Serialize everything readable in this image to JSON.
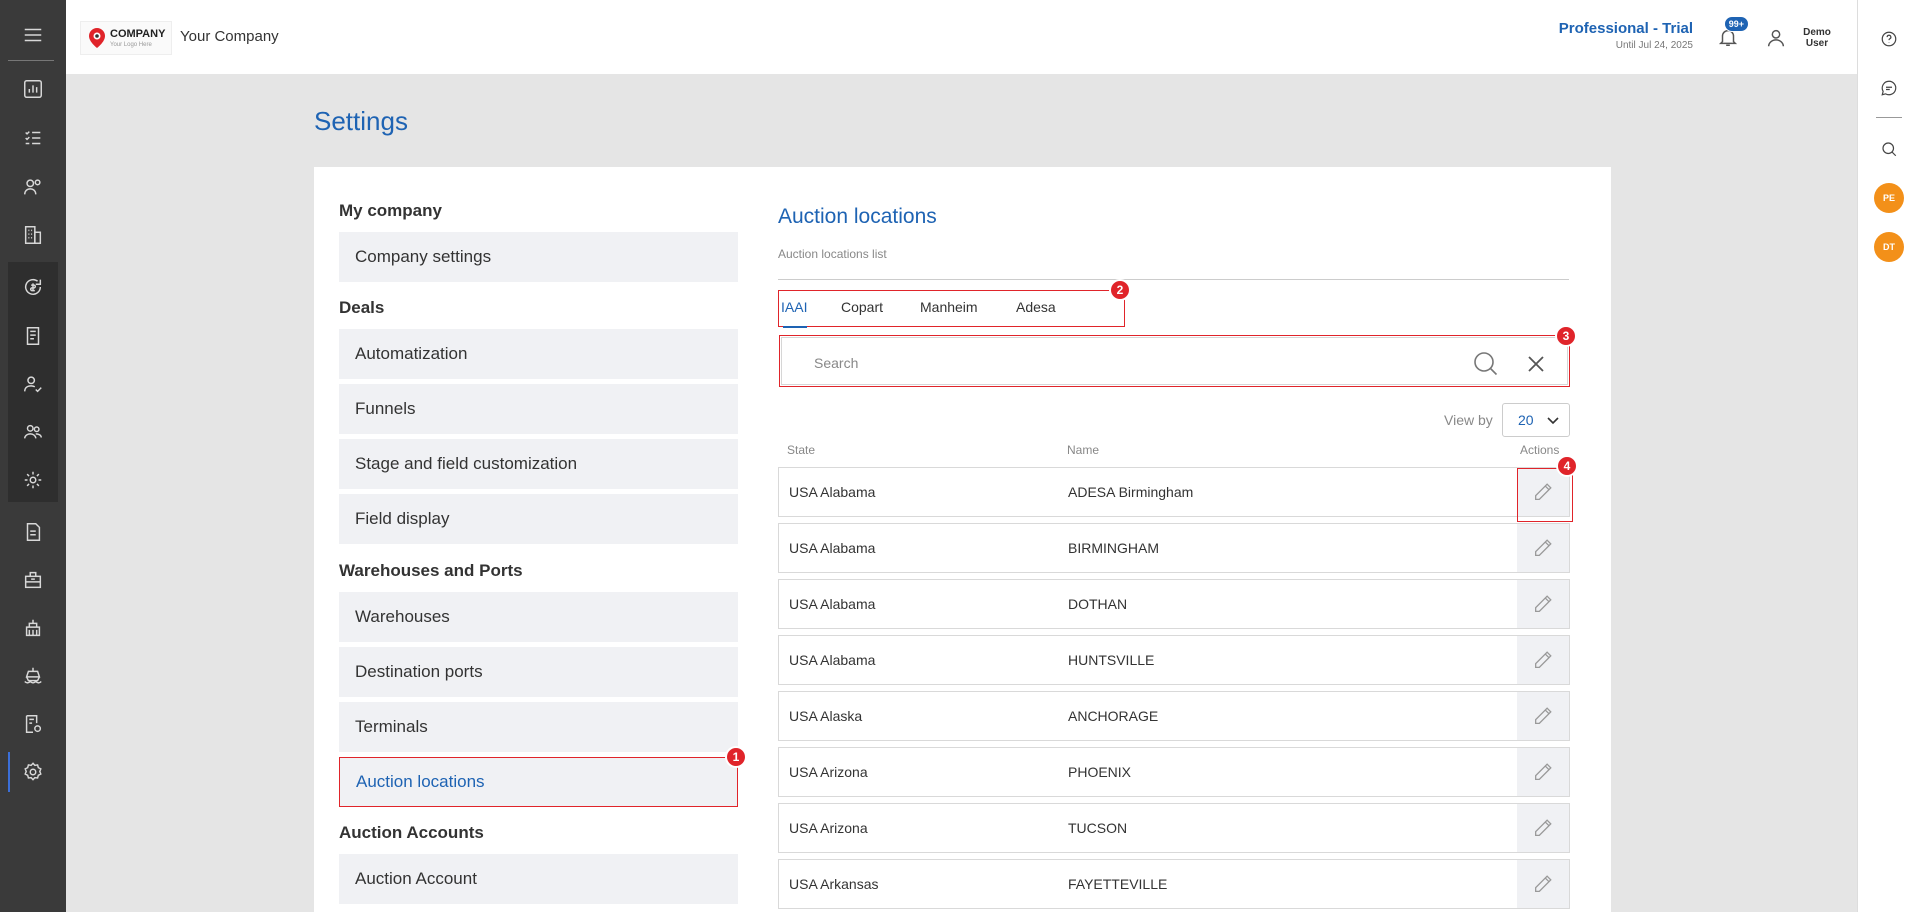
{
  "header": {
    "logo_text": "COMPANY",
    "logo_tagline": "Your Logo Here",
    "company_name": "Your Company",
    "plan_name": "Professional - Trial",
    "plan_until": "Until Jul 24, 2025",
    "notifications_badge": "99+",
    "user_first": "Demo",
    "user_last": "User"
  },
  "right_rail": {
    "avatars": [
      "PE",
      "DT"
    ]
  },
  "page_title": "Settings",
  "settings_nav": {
    "sections": [
      {
        "title": "My company",
        "items": [
          "Company settings"
        ]
      },
      {
        "title": "Deals",
        "items": [
          "Automatization",
          "Funnels",
          "Stage and field customization",
          "Field display"
        ]
      },
      {
        "title": "Warehouses and Ports",
        "items": [
          "Warehouses",
          "Destination ports",
          "Terminals",
          "Auction locations"
        ]
      },
      {
        "title": "Auction Accounts",
        "items": [
          "Auction Account"
        ]
      }
    ],
    "active_item": "Auction locations"
  },
  "content": {
    "title": "Auction locations",
    "subtitle": "Auction locations list",
    "tabs": [
      "IAAI",
      "Copart",
      "Manheim",
      "Adesa"
    ],
    "active_tab": "IAAI",
    "search_placeholder": "Search",
    "view_by_label": "View by",
    "view_by_value": "20",
    "columns": [
      "State",
      "Name",
      "Actions"
    ],
    "rows": [
      {
        "state": "USA Alabama",
        "name": "ADESA Birmingham"
      },
      {
        "state": "USA Alabama",
        "name": "BIRMINGHAM"
      },
      {
        "state": "USA Alabama",
        "name": "DOTHAN"
      },
      {
        "state": "USA Alabama",
        "name": "HUNTSVILLE"
      },
      {
        "state": "USA Alaska",
        "name": "ANCHORAGE"
      },
      {
        "state": "USA Arizona",
        "name": "PHOENIX"
      },
      {
        "state": "USA Arizona",
        "name": "TUCSON"
      },
      {
        "state": "USA Arkansas",
        "name": "FAYETTEVILLE"
      }
    ]
  },
  "annotations": [
    "1",
    "2",
    "3",
    "4"
  ],
  "colors": {
    "accent": "#1e63b3",
    "highlight": "#e0242a",
    "sidebar": "#3a3a3a",
    "avatar": "#f39019"
  }
}
